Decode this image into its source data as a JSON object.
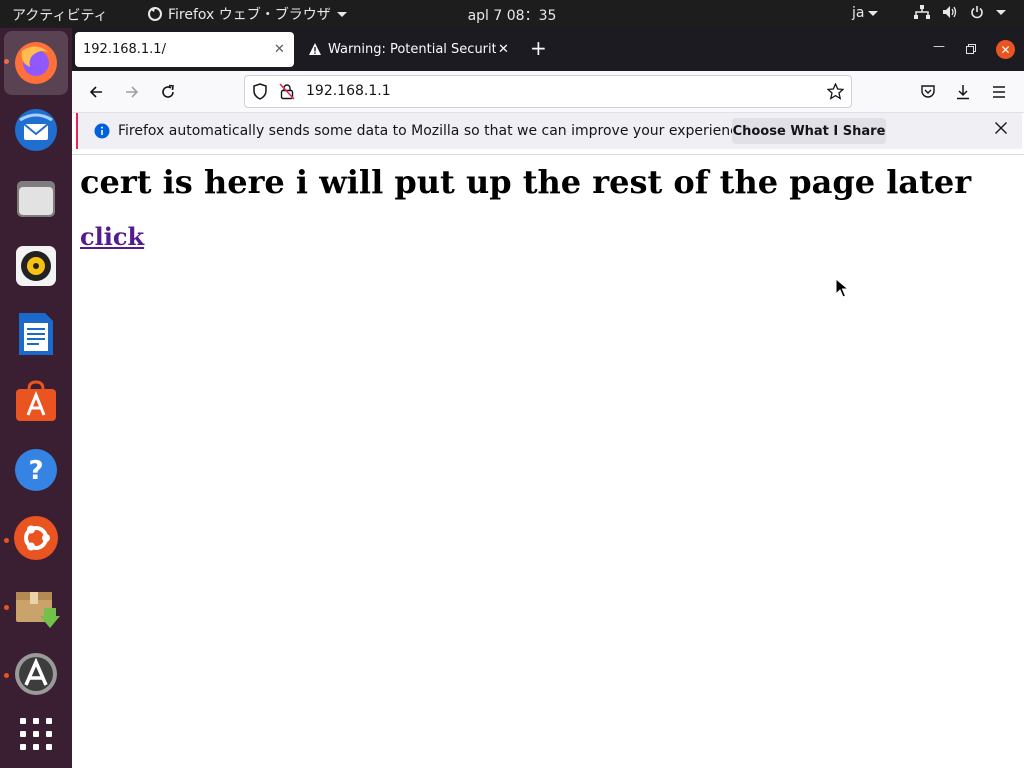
{
  "top_panel": {
    "activities": "アクティビティ",
    "app_name": "Firefox ウェブ・ブラウザ",
    "clock": "apl 7  08：35",
    "lang": "ja",
    "icons": [
      "network-icon",
      "volume-icon",
      "power-icon"
    ]
  },
  "dock": {
    "apps": [
      "firefox-icon",
      "thunderbird-icon",
      "files-icon",
      "rhythmbox-icon",
      "libreoffice-writer-icon",
      "ubuntu-software-icon",
      "help-icon",
      "ubuntu-icon",
      "archive-manager-icon",
      "software-updater-icon",
      "show-apps-icon"
    ]
  },
  "browser": {
    "tabs": [
      {
        "title": "192.168.1.1/",
        "active": true
      },
      {
        "title": "Warning: Potential Security Risk Ahead",
        "active": false
      }
    ],
    "url": "192.168.1.1",
    "infobar": {
      "message": "Firefox automatically sends some data to Mozilla so that we can improve your experience.",
      "button": "Choose What I Share"
    }
  },
  "page": {
    "heading": "cert is here i will put up the rest of the page later",
    "link": "click"
  },
  "colors": {
    "accent": "#e95420",
    "dock_bg": "#3a1f33",
    "tabbar_bg": "#1c1b22",
    "link": "#551a8b"
  }
}
